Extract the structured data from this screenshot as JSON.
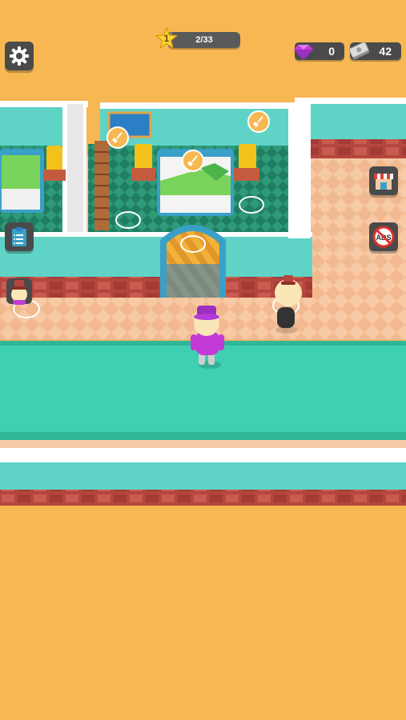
{
  "hud": {
    "level": "1",
    "progress_text": "2/33",
    "progress_fraction": 0.06,
    "gems": "0",
    "cash": "42"
  },
  "icons": {
    "settings": "gear-icon",
    "level": "star-icon",
    "gem": "diamond-icon",
    "cash": "cash-stack-icon",
    "shop": "shop-icon",
    "no_ads": "no-ads-icon",
    "tasks": "clipboard-icon",
    "hire": "bellhop-icon",
    "clean": "broom-icon"
  },
  "colors": {
    "background": "#f7b752",
    "wall_teal": "#5fd3c6",
    "floor_peach": "#f7c9a4",
    "carpet": "#3fcfb2",
    "brick": "#b5463e",
    "player_accent": "#c23bd6"
  },
  "ads_label": "ADS"
}
